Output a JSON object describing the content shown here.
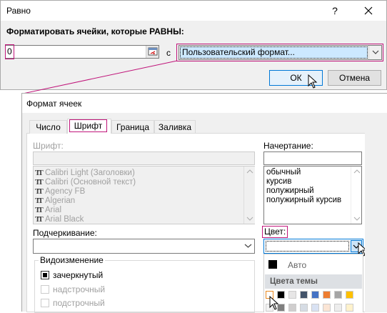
{
  "dialog_equal": {
    "title": "Равно",
    "prompt": "Форматировать ячейки, которые РАВНЫ:",
    "value": "0",
    "with_label": "с",
    "format_selected": "Пользовательский формат...",
    "ok_label": "ОК",
    "cancel_label": "Отмена"
  },
  "dialog_format": {
    "title": "Формат ячеек",
    "tabs": [
      {
        "label": "Число"
      },
      {
        "label": "Шрифт"
      },
      {
        "label": "Граница"
      },
      {
        "label": "Заливка"
      }
    ],
    "font_label": "Шрифт:",
    "font_list": [
      "Calibri Light (Заголовки)",
      "Calibri (Основной текст)",
      "Agency FB",
      "Algerian",
      "Arial",
      "Arial Black"
    ],
    "style_label": "Начертание:",
    "style_list": [
      "обычный",
      "курсив",
      "полужирный",
      "полужирный курсив"
    ],
    "underline_label": "Подчеркивание:",
    "color_label": "Цвет:",
    "effects_label": "Видоизменение",
    "effects": [
      {
        "label": "зачеркнутый",
        "checked": true,
        "enabled": true
      },
      {
        "label": "надстрочный",
        "checked": false,
        "enabled": false
      },
      {
        "label": "подстрочный",
        "checked": false,
        "enabled": false
      }
    ],
    "palette": {
      "auto_label": "Авто",
      "theme_colors_label": "Цвета темы",
      "theme_row1": [
        "#ffffff",
        "#000000",
        "#e7e6e6",
        "#44546a",
        "#4472c4",
        "#ed7d31",
        "#a5a5a5",
        "#ffc000"
      ],
      "theme_row2": [
        "#f2f2f2",
        "#7f7f7f",
        "#d0cece",
        "#d6dce4",
        "#d9e2f3",
        "#fbe5d5",
        "#ededed",
        "#fff2cc"
      ]
    }
  },
  "colors": {
    "highlight": "#c0157a",
    "selection": "#0078d7",
    "dialog_bg": "#f0f0f0"
  }
}
